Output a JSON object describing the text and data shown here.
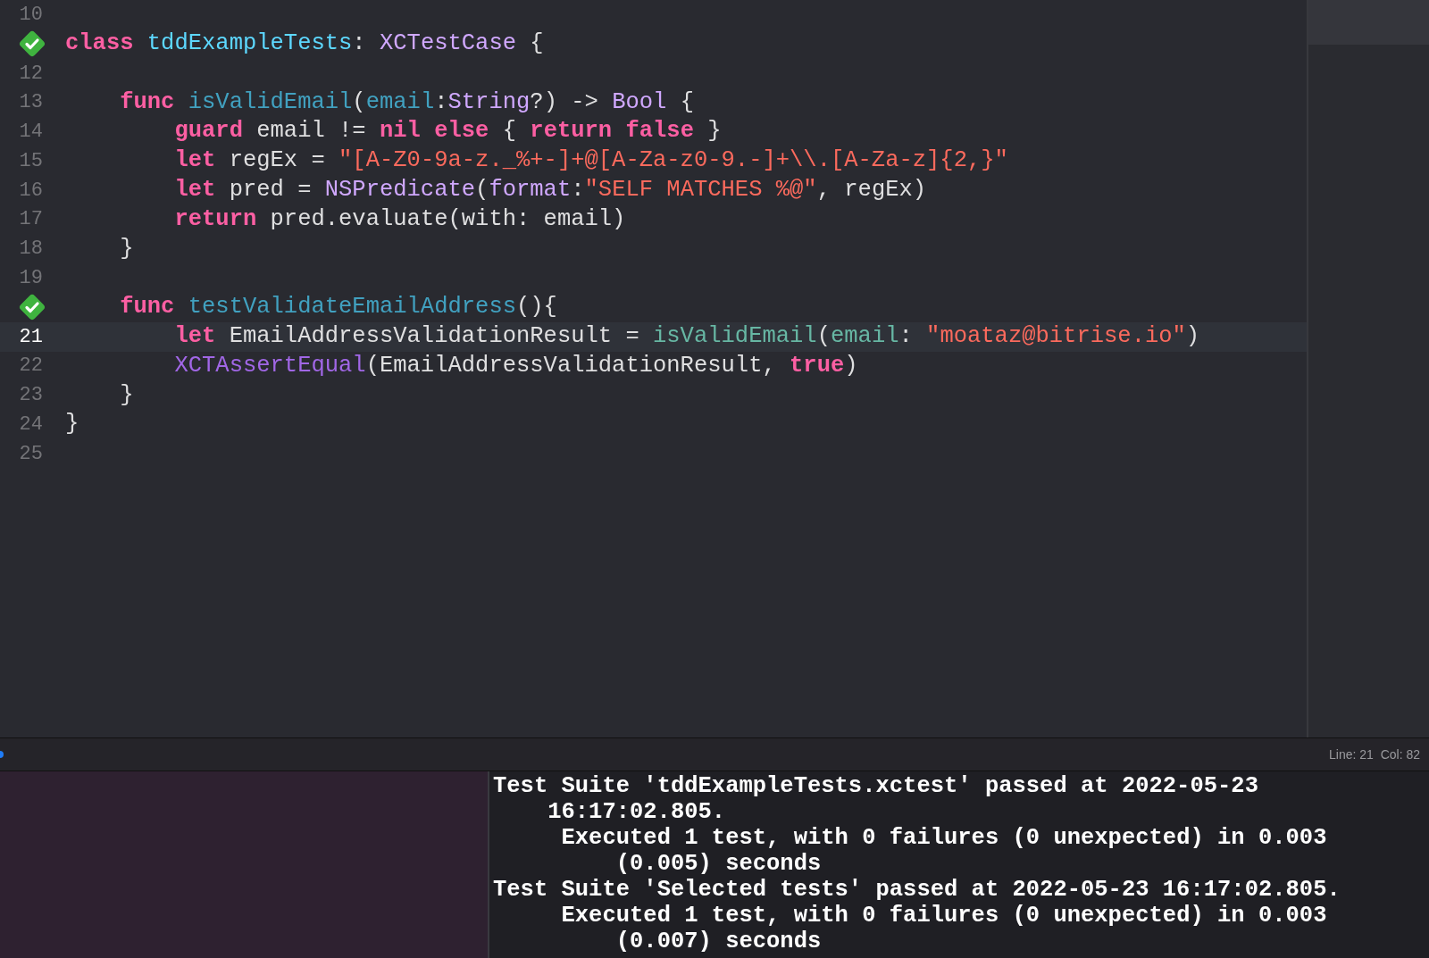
{
  "editor": {
    "code_lines": [
      {
        "number": "10",
        "test_passed": false,
        "current": false
      },
      {
        "test_passed": true,
        "current": false,
        "tokens": [
          {
            "kind": "keyword",
            "text": "class"
          },
          {
            "kind": "decl",
            "text": " tddExampleTests"
          },
          {
            "kind": "plain",
            "text": ": "
          },
          {
            "kind": "type",
            "text": "XCTestCase"
          },
          {
            "kind": "plain",
            "text": " {"
          }
        ]
      },
      {
        "number": "12",
        "test_passed": false,
        "current": false
      },
      {
        "number": "13",
        "test_passed": false,
        "current": false,
        "tokens": [
          {
            "kind": "keyword",
            "text": "    func"
          },
          {
            "kind": "funcdecl",
            "text": " isValidEmail"
          },
          {
            "kind": "plain",
            "text": "("
          },
          {
            "kind": "funcdecl",
            "text": "email"
          },
          {
            "kind": "plain",
            "text": ":"
          },
          {
            "kind": "type",
            "text": "String"
          },
          {
            "kind": "plain",
            "text": "?) -> "
          },
          {
            "kind": "type",
            "text": "Bool"
          },
          {
            "kind": "plain",
            "text": " {"
          }
        ]
      },
      {
        "number": "14",
        "test_passed": false,
        "current": false,
        "tokens": [
          {
            "kind": "keyword",
            "text": "        guard"
          },
          {
            "kind": "plain",
            "text": " email != "
          },
          {
            "kind": "keyword",
            "text": "nil"
          },
          {
            "kind": "keyword",
            "text": " else"
          },
          {
            "kind": "plain",
            "text": " { "
          },
          {
            "kind": "keyword",
            "text": "return"
          },
          {
            "kind": "keyword",
            "text": " false"
          },
          {
            "kind": "plain",
            "text": " }"
          }
        ]
      },
      {
        "number": "15",
        "test_passed": false,
        "current": false,
        "tokens": [
          {
            "kind": "keyword",
            "text": "        let"
          },
          {
            "kind": "plain",
            "text": " regEx = "
          },
          {
            "kind": "string",
            "text": "\"[A-Z0-9a-z._%+-]+@[A-Za-z0-9.-]+\\\\.[A-Za-z]{2,}\""
          }
        ]
      },
      {
        "number": "16",
        "test_passed": false,
        "current": false,
        "tokens": [
          {
            "kind": "keyword",
            "text": "        let"
          },
          {
            "kind": "plain",
            "text": " pred = "
          },
          {
            "kind": "type",
            "text": "NSPredicate"
          },
          {
            "kind": "plain",
            "text": "("
          },
          {
            "kind": "type",
            "text": "format"
          },
          {
            "kind": "plain",
            "text": ":"
          },
          {
            "kind": "string",
            "text": "\"SELF MATCHES %@\""
          },
          {
            "kind": "plain",
            "text": ", regEx)"
          }
        ]
      },
      {
        "number": "17",
        "test_passed": false,
        "current": false,
        "tokens": [
          {
            "kind": "keyword",
            "text": "        return"
          },
          {
            "kind": "plain",
            "text": " pred.evaluate(with: email)"
          }
        ]
      },
      {
        "number": "18",
        "test_passed": false,
        "current": false,
        "tokens": [
          {
            "kind": "plain",
            "text": "    }"
          }
        ]
      },
      {
        "number": "19",
        "test_passed": false,
        "current": false
      },
      {
        "test_passed": true,
        "current": false,
        "tokens": [
          {
            "kind": "keyword",
            "text": "    func"
          },
          {
            "kind": "funcdecl",
            "text": " testValidateEmailAddress"
          },
          {
            "kind": "plain",
            "text": "(){"
          }
        ]
      },
      {
        "number": "21",
        "test_passed": false,
        "current": true,
        "tokens": [
          {
            "kind": "keyword",
            "text": "        let"
          },
          {
            "kind": "plain",
            "text": " EmailAddressValidationResult = "
          },
          {
            "kind": "projectfunc",
            "text": "isValidEmail"
          },
          {
            "kind": "plain",
            "text": "("
          },
          {
            "kind": "projectfunc",
            "text": "email"
          },
          {
            "kind": "plain",
            "text": ": "
          },
          {
            "kind": "string",
            "text": "\"moataz@bitrise.io\""
          },
          {
            "kind": "plain",
            "text": ")"
          }
        ]
      },
      {
        "number": "22",
        "test_passed": false,
        "current": false,
        "tokens": [
          {
            "kind": "sdkfunc",
            "text": "        XCTAssertEqual"
          },
          {
            "kind": "plain",
            "text": "(EmailAddressValidationResult, "
          },
          {
            "kind": "keyword",
            "text": "true"
          },
          {
            "kind": "plain",
            "text": ")"
          }
        ]
      },
      {
        "number": "23",
        "test_passed": false,
        "current": false,
        "tokens": [
          {
            "kind": "plain",
            "text": "    }"
          }
        ]
      },
      {
        "number": "24",
        "test_passed": false,
        "current": false,
        "tokens": [
          {
            "kind": "plain",
            "text": "}"
          }
        ]
      },
      {
        "number": "25",
        "test_passed": false,
        "current": false
      }
    ]
  },
  "status_bar": {
    "position": "Line: 21  Col: 82"
  },
  "console": {
    "lines": [
      {
        "kind": "suite",
        "text": "Test Suite 'tddExampleTests.xctest' passed at 2022-05-23 16:17:02.805."
      },
      {
        "kind": "executed",
        "text": "Executed 1 test, with 0 failures (0 unexpected) in 0.003 (0.005) seconds"
      },
      {
        "kind": "suite",
        "text": "Test Suite 'Selected tests' passed at 2022-05-23 16:17:02.805."
      },
      {
        "kind": "executed",
        "text": "Executed 1 test, with 0 failures (0 unexpected) in 0.003 (0.007) seconds"
      }
    ]
  }
}
